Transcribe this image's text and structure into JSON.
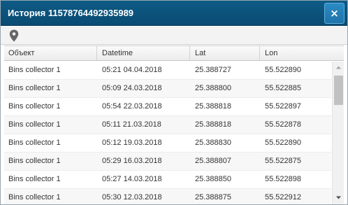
{
  "window": {
    "title": "История 11578764492935989",
    "close_label": "×"
  },
  "toolbar": {
    "icon": "map-pin-icon"
  },
  "grid": {
    "columns": [
      "Объект",
      "Datetime",
      "Lat",
      "Lon"
    ],
    "rows": [
      [
        "Bins collector 1",
        "05:21 04.04.2018",
        "25.388727",
        "55.522890"
      ],
      [
        "Bins collector 1",
        "05:09 24.03.2018",
        "25.388800",
        "55.522885"
      ],
      [
        "Bins collector 1",
        "05:54 22.03.2018",
        "25.388818",
        "55.522897"
      ],
      [
        "Bins collector 1",
        "05:11 21.03.2018",
        "25.388818",
        "55.522878"
      ],
      [
        "Bins collector 1",
        "05:12 19.03.2018",
        "25.388830",
        "55.522890"
      ],
      [
        "Bins collector 1",
        "05:29 16.03.2018",
        "25.388807",
        "55.522875"
      ],
      [
        "Bins collector 1",
        "05:27 14.03.2018",
        "25.388850",
        "55.522898"
      ],
      [
        "Bins collector 1",
        "05:30 12.03.2018",
        "25.388875",
        "55.522912"
      ]
    ]
  },
  "scrollbar": {
    "up_icon": "arrow-up-icon",
    "down_icon": "arrow-down-icon"
  }
}
